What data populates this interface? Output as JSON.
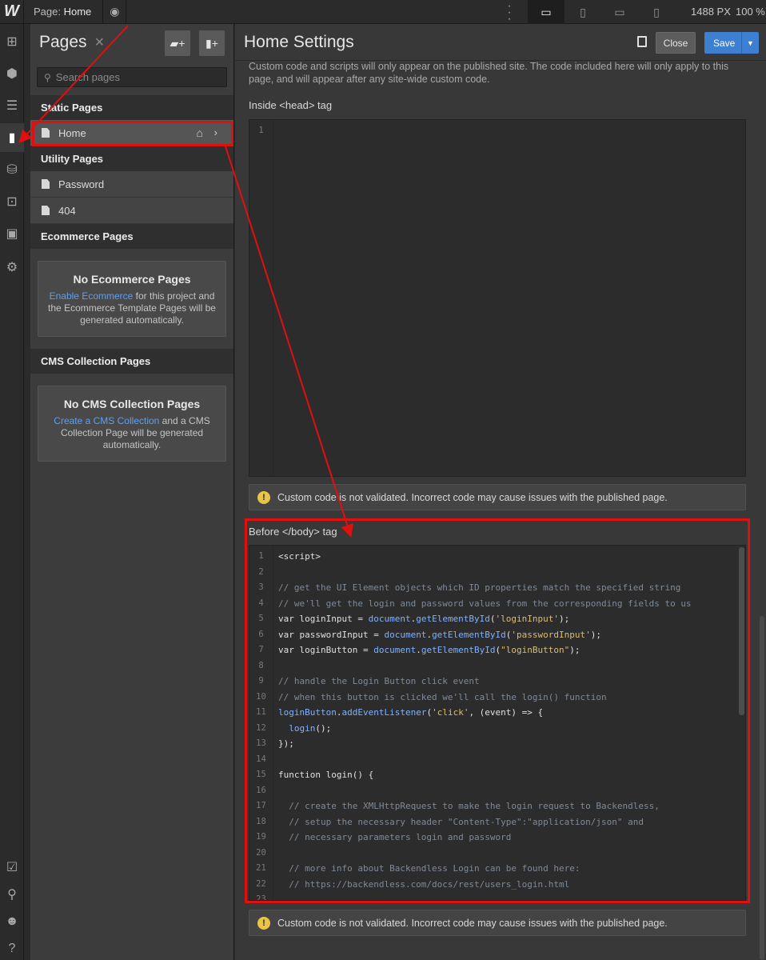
{
  "topbar": {
    "logo": "W",
    "page_prefix": "Page:",
    "page_name": "Home",
    "width_readout": "1488 PX",
    "zoom_readout": "100 %",
    "devices": [
      {
        "name": "desktop-icon",
        "glyph": "▭",
        "active": true
      },
      {
        "name": "tablet-icon",
        "glyph": "▯",
        "active": false
      },
      {
        "name": "mobile-landscape-icon",
        "glyph": "▭",
        "active": false
      },
      {
        "name": "mobile-portrait-icon",
        "glyph": "▯",
        "active": false
      }
    ]
  },
  "rail": {
    "items": [
      {
        "name": "add-elements-icon",
        "glyph": "⊞"
      },
      {
        "name": "symbols-icon",
        "glyph": "⬢"
      },
      {
        "name": "navigator-icon",
        "glyph": "☰"
      },
      {
        "name": "pages-icon",
        "glyph": "▮"
      },
      {
        "name": "cms-icon",
        "glyph": "⛁"
      },
      {
        "name": "ecommerce-icon",
        "glyph": "⊡"
      },
      {
        "name": "assets-icon",
        "glyph": "▣"
      },
      {
        "name": "settings-gear-icon",
        "glyph": "⚙"
      }
    ],
    "bottom": [
      {
        "name": "audit-check-icon",
        "glyph": "☑"
      },
      {
        "name": "search-icon",
        "glyph": "⚲"
      },
      {
        "name": "collaborators-icon",
        "glyph": "☻"
      },
      {
        "name": "help-icon",
        "glyph": "?"
      }
    ]
  },
  "pages_panel": {
    "title": "Pages",
    "close_glyph": "×",
    "search_placeholder": "Search pages",
    "static_header": "Static Pages",
    "static_pages": [
      {
        "label": "Home"
      }
    ],
    "utility_header": "Utility Pages",
    "utility_pages": [
      {
        "label": "Password"
      },
      {
        "label": "404"
      }
    ],
    "ecommerce_header": "Ecommerce Pages",
    "ecommerce_empty": {
      "title": "No Ecommerce Pages",
      "link": "Enable Ecommerce",
      "text": " for this project and the Ecommerce Template Pages will be generated automatically."
    },
    "cms_header": "CMS Collection Pages",
    "cms_empty": {
      "title": "No CMS Collection Pages",
      "link": "Create a CMS Collection",
      "text": " and a CMS Collection Page will be generated automatically."
    }
  },
  "settings": {
    "title": "Home Settings",
    "close_label": "Close",
    "save_label": "Save",
    "info_text": "Custom code and scripts will only appear on the published site. The code included here will only apply to this page, and will appear after any site-wide custom code.",
    "head_label": "Inside <head> tag",
    "body_label": "Before </body> tag",
    "warning": "Custom code is not validated. Incorrect code may cause issues with the published page.",
    "head_code_lines": [
      "1"
    ],
    "body_code": [
      {
        "n": "1",
        "t": "<script>",
        "c": "kw"
      },
      {
        "n": "2",
        "t": "",
        "c": "kw"
      },
      {
        "n": "3",
        "t": "// get the UI Element objects which ID properties match the specified string",
        "c": "cm"
      },
      {
        "n": "4",
        "t": "// we'll get the login and password values from the corresponding fields to us",
        "c": "cm"
      },
      {
        "n": "5",
        "t": "var loginInput = document.getElementById('loginInput');",
        "c": "mix"
      },
      {
        "n": "6",
        "t": "var passwordInput = document.getElementById('passwordInput');",
        "c": "mix"
      },
      {
        "n": "7",
        "t": "var loginButton = document.getElementById(\"loginButton\");",
        "c": "mix"
      },
      {
        "n": "8",
        "t": "",
        "c": "kw"
      },
      {
        "n": "9",
        "t": "// handle the Login Button click event",
        "c": "cm"
      },
      {
        "n": "10",
        "t": "// when this button is clicked we'll call the login() function",
        "c": "cm"
      },
      {
        "n": "11",
        "t": "loginButton.addEventListener('click', (event) => {",
        "c": "mix"
      },
      {
        "n": "12",
        "t": "  login();",
        "c": "mix"
      },
      {
        "n": "13",
        "t": "});",
        "c": "kw"
      },
      {
        "n": "14",
        "t": "",
        "c": "kw"
      },
      {
        "n": "15",
        "t": "function login() {",
        "c": "kw"
      },
      {
        "n": "16",
        "t": "",
        "c": "kw"
      },
      {
        "n": "17",
        "t": "  // create the XMLHttpRequest to make the login request to Backendless,",
        "c": "cm"
      },
      {
        "n": "18",
        "t": "  // setup the necessary header \"Content-Type\":\"application/json\" and",
        "c": "cm"
      },
      {
        "n": "19",
        "t": "  // necessary parameters login and password",
        "c": "cm"
      },
      {
        "n": "20",
        "t": "",
        "c": "kw"
      },
      {
        "n": "21",
        "t": "  // more info about Backendless Login can be found here:",
        "c": "cm"
      },
      {
        "n": "22",
        "t": "  // https://backendless.com/docs/rest/users_login.html",
        "c": "cm"
      },
      {
        "n": "23",
        "t": "",
        "c": "kw"
      }
    ]
  },
  "colors": {
    "accent": "#3d7fd1",
    "annotation": "#e01010",
    "link": "#5f9ff0",
    "warning": "#e8c547"
  }
}
